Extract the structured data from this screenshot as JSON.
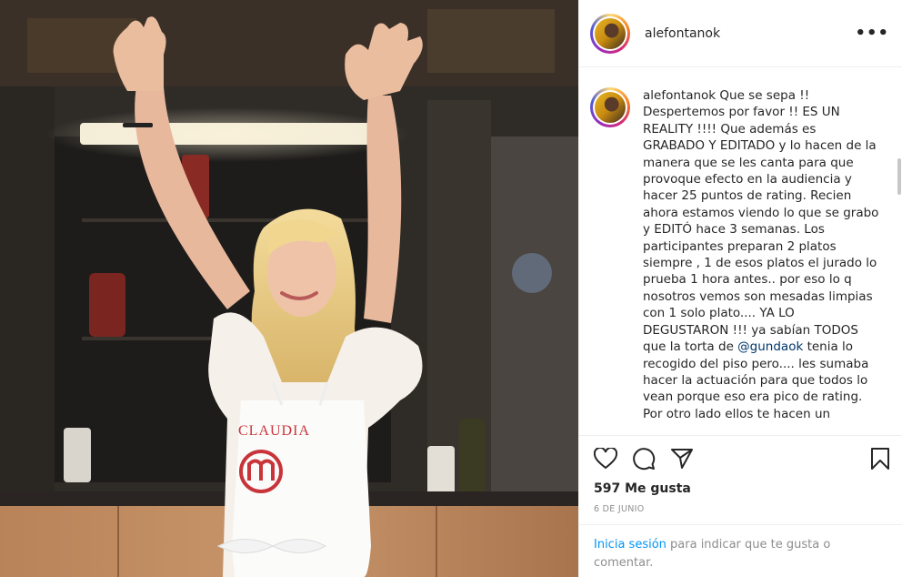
{
  "post": {
    "username": "alefontanok",
    "more_label": "•••",
    "caption_username": "alefontanok",
    "caption_before_mention": " Que se sepa !! Despertemos por favor !! ES UN REALITY !!!! Que además es GRABADO Y EDITADO y lo hacen de la manera que se les canta para que provoque efecto en la audiencia y hacer 25 puntos de rating. Recien ahora estamos viendo lo que se grabo y EDITÓ hace 3 semanas. Los participantes preparan 2 platos siempre , 1 de esos platos el jurado lo prueba 1 hora antes.. por eso lo q nosotros vemos son mesadas limpias con 1 solo plato.... YA LO DEGUSTARON !!! ya sabían TODOS que la torta de ",
    "mention": "@gundaok",
    "caption_after_mention": " tenia lo recogido del piso pero.... les sumaba hacer la actuación para que todos lo vean porque eso era pico de rating. Por otro lado ellos te hacen un",
    "likes": "597 Me gusta",
    "date": "6 DE JUNIO",
    "login_link": "Inicia sesión",
    "login_rest": " para indicar que te gusta o comentar."
  },
  "photo": {
    "apron_text": "CLAUDIA",
    "apron_logo": "m"
  },
  "icons": {
    "like": "heart-icon",
    "comment": "comment-icon",
    "share": "share-icon",
    "save": "bookmark-icon"
  },
  "colors": {
    "link": "#0095f6",
    "mention": "#00376b",
    "apron_red": "#c8343a",
    "muted": "#8e8e8e"
  }
}
